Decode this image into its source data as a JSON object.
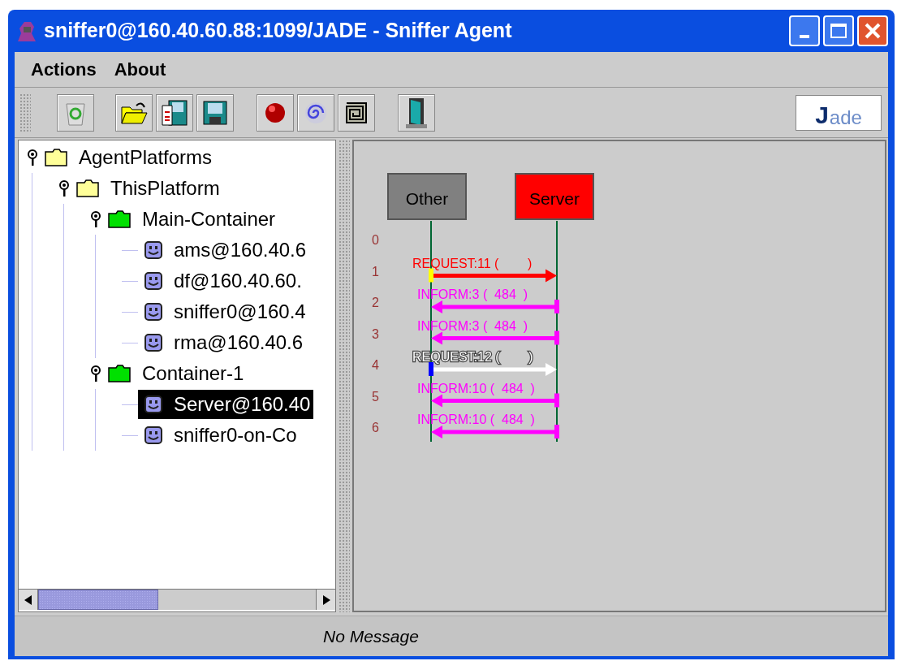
{
  "window": {
    "title": "sniffer0@160.40.60.88:1099/JADE - Sniffer Agent"
  },
  "menu": [
    "Actions",
    "About"
  ],
  "logo": {
    "mark": "J",
    "rest": "ade"
  },
  "tree": [
    {
      "label": "AgentPlatforms",
      "kind": "platform",
      "expanded": true,
      "selected": false,
      "children": [
        {
          "label": "ThisPlatform",
          "kind": "platform",
          "expanded": true,
          "selected": false,
          "children": [
            {
              "label": "Main-Container",
              "kind": "container",
              "expanded": true,
              "selected": false,
              "children": [
                {
                  "label": "ams@160.40.6",
                  "kind": "agent",
                  "selected": false
                },
                {
                  "label": "df@160.40.60.",
                  "kind": "agent",
                  "selected": false
                },
                {
                  "label": "sniffer0@160.4",
                  "kind": "agent",
                  "selected": false
                },
                {
                  "label": "rma@160.40.6",
                  "kind": "agent",
                  "selected": false
                }
              ]
            },
            {
              "label": "Container-1",
              "kind": "container",
              "expanded": true,
              "selected": false,
              "children": [
                {
                  "label": "Server@160.40",
                  "kind": "agent",
                  "selected": true
                },
                {
                  "label": "sniffer0-on-Co",
                  "kind": "agent",
                  "selected": false
                }
              ]
            }
          ]
        }
      ]
    }
  ],
  "diagram": {
    "agents": [
      {
        "name": "Other",
        "color": "#808080"
      },
      {
        "name": "Server",
        "color": "#ff0000"
      }
    ],
    "rows": [
      "0",
      "1",
      "2",
      "3",
      "4",
      "5",
      "6"
    ],
    "messages": [
      {
        "label": "REQUEST:11 (        )",
        "kind": "request",
        "color": "#ff0000",
        "marker": {
          "color": "#ffff00"
        }
      },
      {
        "label": "INFORM:3 (  484  )",
        "kind": "inform",
        "color": "#ff00ff",
        "marker": {
          "color": "#ff00ff"
        }
      },
      {
        "label": "INFORM:3 (  484  )",
        "kind": "inform",
        "color": "#ff00ff",
        "marker": {
          "color": "#ff00ff"
        }
      },
      {
        "label": "REQUEST:12 (        )",
        "kind": "request",
        "color": "#ffffff",
        "marker": {
          "color": "#0000ff"
        }
      },
      {
        "label": "INFORM:10 (  484  )",
        "kind": "inform",
        "color": "#ff00ff",
        "marker": {
          "color": "#ff00ff"
        }
      },
      {
        "label": "INFORM:10 (  484  )",
        "kind": "inform",
        "color": "#ff00ff",
        "marker": {
          "color": "#ff00ff"
        }
      }
    ]
  },
  "status_bar": {
    "message": "No Message"
  }
}
